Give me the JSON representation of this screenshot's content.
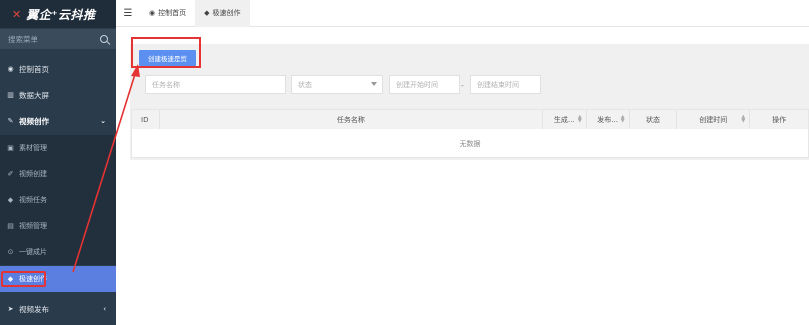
{
  "app": {
    "logo_text": "翼企⁺云抖推",
    "logo_mark": "✕"
  },
  "sidebar": {
    "search_placeholder": "搜索菜单",
    "items": [
      {
        "label": "控制首页",
        "icon": "dashboard-icon"
      },
      {
        "label": "数据大屏",
        "icon": "bar-chart-icon"
      },
      {
        "label": "视频创作",
        "icon": "pencil-icon",
        "expanded": true
      },
      {
        "label": "素材管理",
        "icon": "image-icon"
      },
      {
        "label": "视频创建",
        "icon": "pencil-icon"
      },
      {
        "label": "视频任务",
        "icon": "tag-icon"
      },
      {
        "label": "视频管理",
        "icon": "film-icon"
      },
      {
        "label": "一键成片",
        "icon": "circle-icon"
      },
      {
        "label": "极速创作",
        "icon": "tag-icon",
        "active": true
      },
      {
        "label": "视频发布",
        "icon": "send-icon"
      }
    ]
  },
  "topbar": {
    "tabs": [
      {
        "label": "控制首页",
        "icon": "dashboard-icon"
      },
      {
        "label": "极速创作",
        "icon": "tag-icon",
        "active": true
      }
    ]
  },
  "toolbar": {
    "create_label": "创建极速是剪"
  },
  "filters": {
    "task_name_placeholder": "任务名称",
    "status_placeholder": "状态",
    "start_time_placeholder": "创建开始时间",
    "separator": "-",
    "end_time_placeholder": "创建结束时间"
  },
  "table": {
    "columns": [
      "ID",
      "任务名称",
      "生成...",
      "发布...",
      "状态",
      "创建时间",
      "操作"
    ],
    "empty_text": "无数据"
  },
  "colors": {
    "sidebar_bg": "#2a3b4c",
    "accent": "#5b8ff0",
    "highlight": "#e53232",
    "active_item": "#5b7fe0"
  }
}
